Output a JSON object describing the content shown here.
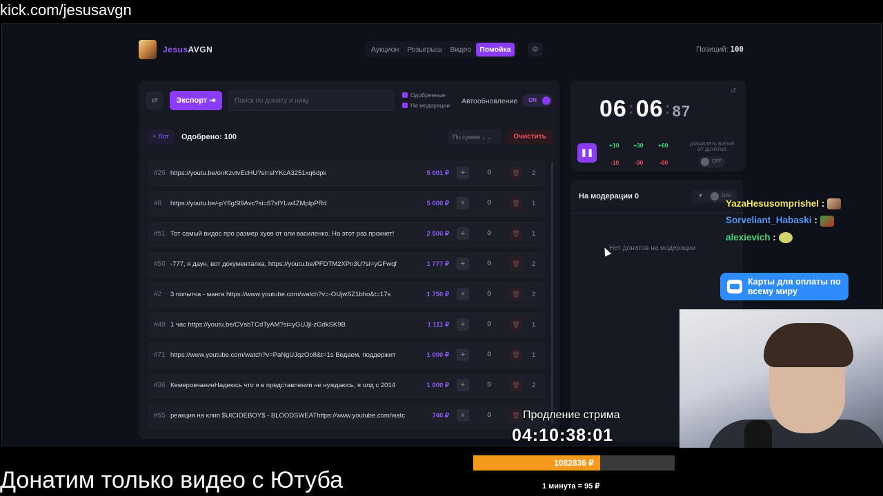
{
  "browser": {
    "url": "kick.com/jesusavgn"
  },
  "header": {
    "brand_part1": "Jesus",
    "brand_part2": "AVGN",
    "nav": [
      "Аукцион",
      "Розыгрыш",
      "Видео",
      "Помойка"
    ],
    "active_nav": "Помойка",
    "positions_label": "Позиций:",
    "positions_value": "100"
  },
  "toolbar": {
    "export_label": "Экспорт",
    "search_placeholder": "Поиск по донату и нику",
    "filter_approved": "Одобренные",
    "filter_moderation": "На модерации",
    "autoupdate_label": "Автообновление",
    "autoupdate_state": "ON"
  },
  "list_header": {
    "lot_label": "+ Лот",
    "approved_label": "Одобрено: 100",
    "sort_label": "По сумме ↓",
    "clear_label": "Очистить"
  },
  "donations": [
    {
      "id": "#26",
      "message": "https://youtu.be/onKzvtvEcHU?si=slYKcA3251xq6dpk",
      "amount": "5 001 ₽",
      "qty": "0",
      "count": "2"
    },
    {
      "id": "#8",
      "message": "https://youtu.be/-pY6gSl9Avc?si=67sfYLw4ZMplpPRd",
      "amount": "5 000 ₽",
      "qty": "0",
      "count": "1"
    },
    {
      "id": "#51",
      "message": "Тот самый видос про размер хуев от оли василенко. На этот раз прокнет!",
      "amount": "2 500 ₽",
      "qty": "0",
      "count": "1"
    },
    {
      "id": "#50",
      "message": "-777, я даун, вот документалка, https://youtu.be/PFDTM2XPn3U?si=yGFwqf",
      "amount": "1 777 ₽",
      "qty": "0",
      "count": "2"
    },
    {
      "id": "#2",
      "message": "3 попытка - манга https://www.youtube.com/watch?v=-OUjwSZ1bho&t=17s",
      "amount": "1 750 ₽",
      "qty": "0",
      "count": "2"
    },
    {
      "id": "#49",
      "message": "1 час https://youtu.be/CVsbTCdTyAM?si=yGUJjl-zGdkSK9B",
      "amount": "1 111 ₽",
      "qty": "0",
      "count": "1"
    },
    {
      "id": "#71",
      "message": "https://www.youtube.com/watch?v=PaNgUJqzOo8&t=1s Ведаем, поддержит",
      "amount": "1 000 ₽",
      "qty": "0",
      "count": "1"
    },
    {
      "id": "#36",
      "message": "КемеровчанинНадеюсь что я в представлении не нуждаюсь, я олд с 2014",
      "amount": "1 000 ₽",
      "qty": "0",
      "count": "2"
    },
    {
      "id": "#55",
      "message": "реакция на клип $UICIDEBOY$ - BLOODSWEAThttps://www.youtube.com/watc",
      "amount": "740 ₽",
      "qty": "0",
      "count": ""
    }
  ],
  "timer": {
    "hours": "06",
    "minutes": "06",
    "centis": "87",
    "plus": [
      "+10",
      "+30",
      "+60"
    ],
    "minus": [
      "-10",
      "-30",
      "-60"
    ],
    "add_time_label": "ДОБАВЛЯТЬ ВРЕМЯ ОТ ДОНАТОВ",
    "add_time_state": "OFF"
  },
  "moderation": {
    "title": "На модерации",
    "count": "0",
    "filter_state": "OFF",
    "empty_text": "Нет донатов на модерации"
  },
  "chat": [
    {
      "user": "YazaHesusomprishel",
      "sep": " :"
    },
    {
      "user": "Sorveliant_Habaski",
      "sep": " :"
    },
    {
      "user": "alexievich",
      "sep": " :"
    }
  ],
  "ad": {
    "text": "Карты для оплаты по всему миру"
  },
  "stream": {
    "extend_label": "Продление стрима",
    "extend_timer": "04:10:38:01",
    "progress_text": "1082836 ₽",
    "progress_fraction": 0.63,
    "rate_text": "1 минута = 95 ₽",
    "caption": "Донатим только видео с Ютуба"
  },
  "colors": {
    "accent": "#8b3cf7",
    "bg": "#0f1118",
    "panel": "#171a22",
    "progress": "#f59a1d"
  }
}
